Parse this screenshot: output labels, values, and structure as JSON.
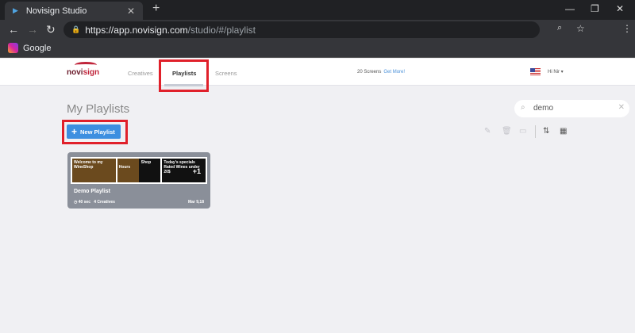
{
  "browser": {
    "tab_title": "Novisign Studio",
    "url_host": "https://app.novisign.com",
    "url_path": "/studio/#/playlist",
    "bookmark": "Google"
  },
  "header": {
    "logo": "novisign",
    "nav": [
      {
        "label": "Creatives"
      },
      {
        "label": "Playlists",
        "active": true
      },
      {
        "label": "Screens"
      }
    ],
    "screens": "20 Screens",
    "get_more": "Get More!",
    "user": "Hi Nir"
  },
  "main": {
    "title": "My Playlists",
    "new_playlist": "New Playlist",
    "search": {
      "value": "demo"
    }
  },
  "playlists": [
    {
      "name": "Demo Playlist",
      "duration": "40 sec",
      "creatives": "4 Creatives",
      "date": "Mar 9,18",
      "thumbs": [
        "Welcome to my WineShop",
        "Shop Hours",
        "Today's specials Rated Wines under 20$"
      ],
      "more": "+1"
    }
  ],
  "colors": {
    "accent": "#3d8fe0",
    "highlight": "#e0202a"
  }
}
